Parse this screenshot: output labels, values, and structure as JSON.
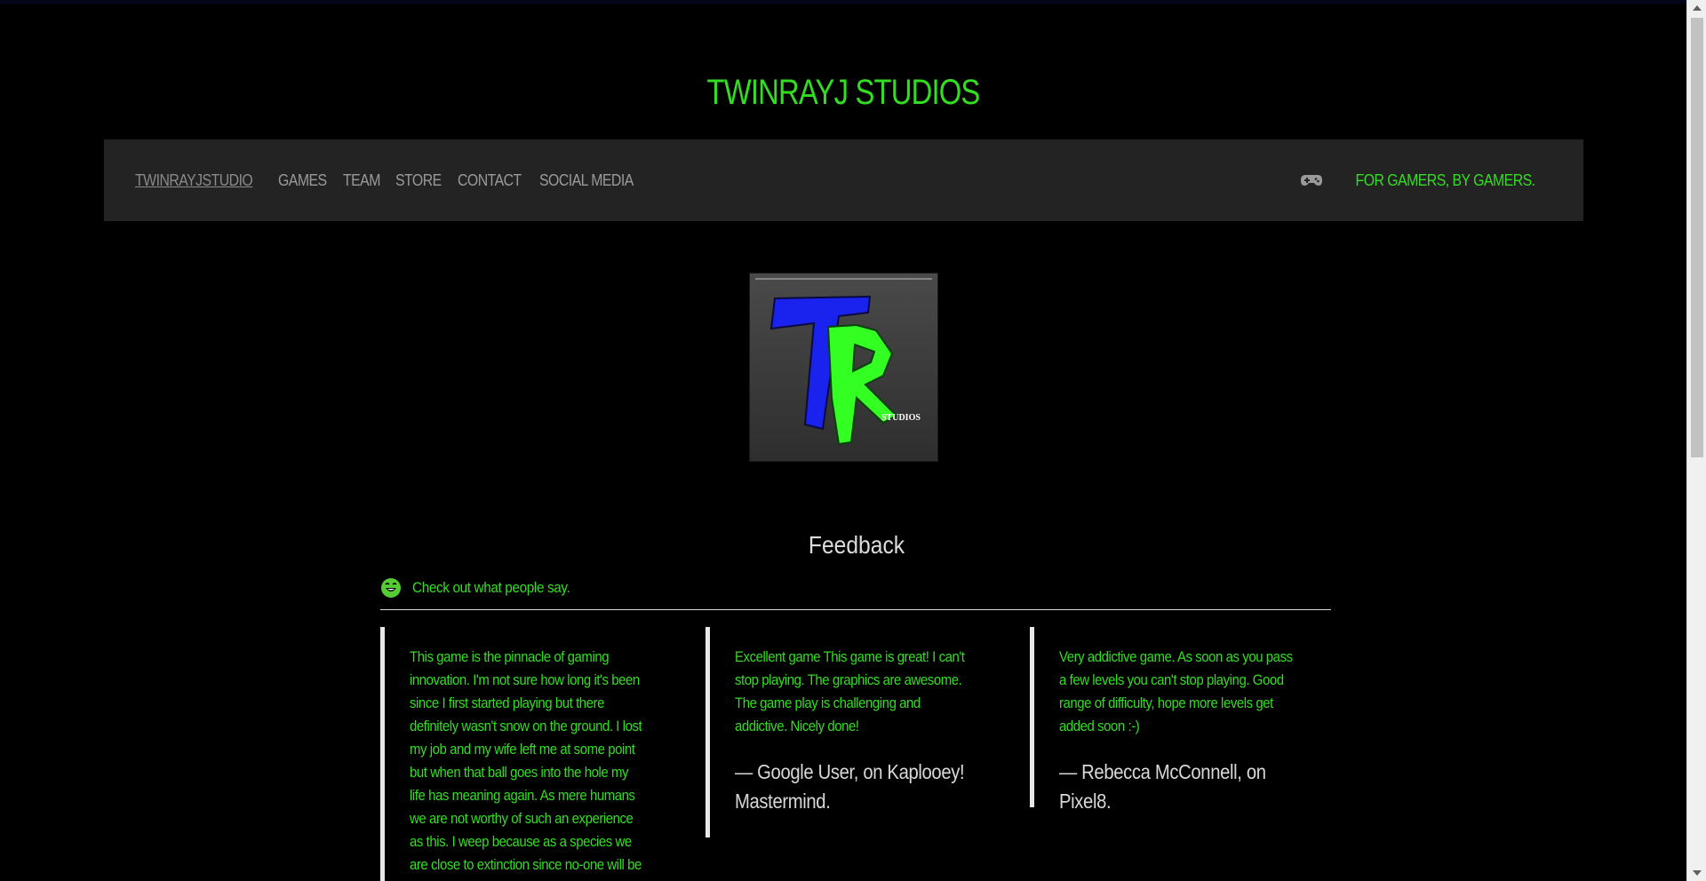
{
  "site": {
    "title": "TWINRAYJ STUDIOS"
  },
  "nav": {
    "items": [
      {
        "label": "TWINRAYJSTUDIO",
        "active": true
      },
      {
        "label": "GAMES"
      },
      {
        "label": "TEAM"
      },
      {
        "label": "STORE"
      },
      {
        "label": "CONTACT"
      },
      {
        "label": "SOCIAL MEDIA"
      }
    ],
    "tagline": "FOR GAMERS, BY GAMERS.",
    "tagline_icon": "gamepad-icon"
  },
  "logo": {
    "letters": "TR",
    "caption": "STUDIOS",
    "colors": {
      "t": "#1a22ee",
      "r": "#33ff22",
      "bg": "#3a3a3a"
    }
  },
  "feedback": {
    "title": "Feedback",
    "subhead_icon": "smile-icon",
    "subhead": "Check out what people say.",
    "quotes": [
      {
        "text": "This game is the pinnacle of gaming innovation. I'm not sure how long it's been since I first started playing but there definitely wasn't snow on the ground. I lost my job and my wife left me at some point but when that ball goes into the hole my life has meaning again. As mere humans we are not worthy of such an experience as this. I weep because as a species we are close to extinction since no-one will be leaving their house ever again after playing this game. There is no doubt in",
        "cite": ""
      },
      {
        "text": "Excellent game This game is great! I can't stop playing. The graphics are awesome. The game play is challenging and addictive. Nicely done!",
        "cite": "— Google User, on Kaplooey! Mastermind."
      },
      {
        "text": "Very addictive game. As soon as you pass a few levels you can't stop playing. Good range of difficulty, hope more levels get added soon :-)",
        "cite": "— Rebecca McConnell, on Pixel8."
      }
    ]
  },
  "colors": {
    "accent": "#33dd22",
    "navbar": "#232323",
    "background": "#000000"
  }
}
